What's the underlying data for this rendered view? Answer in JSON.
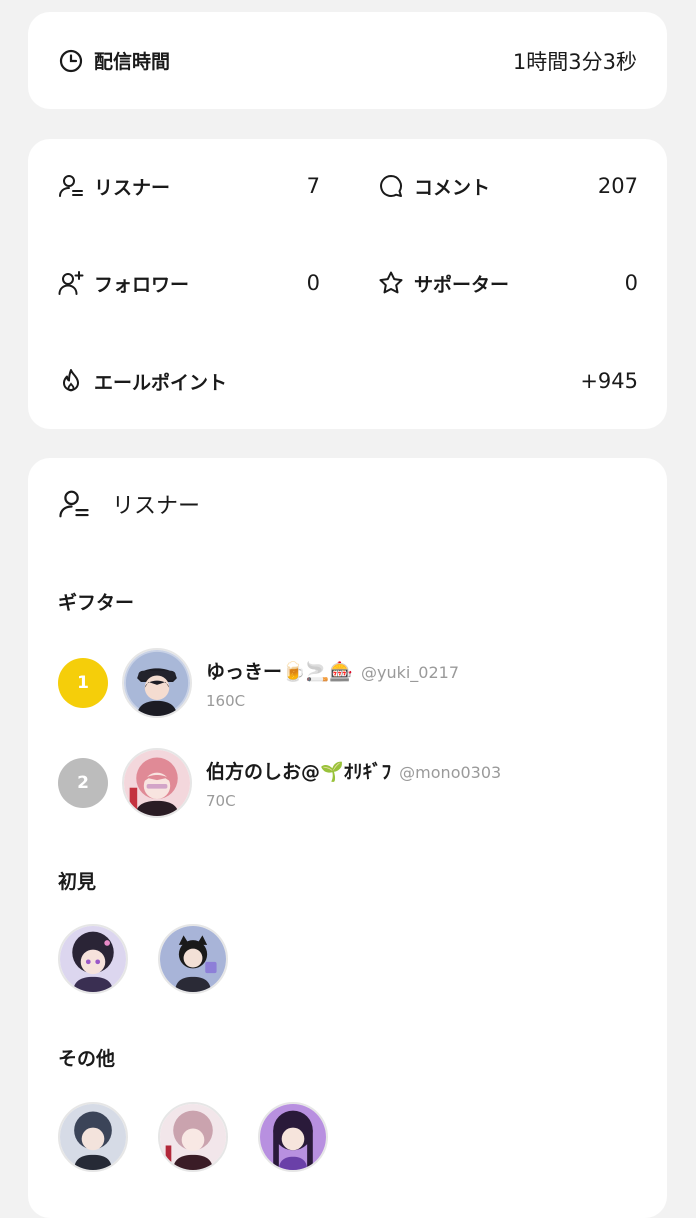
{
  "broadcast": {
    "label": "配信時間",
    "value": "1時間3分3秒"
  },
  "stats": {
    "listeners": {
      "label": "リスナー",
      "value": "7"
    },
    "comments": {
      "label": "コメント",
      "value": "207"
    },
    "followers": {
      "label": "フォロワー",
      "value": "0"
    },
    "supporters": {
      "label": "サポーター",
      "value": "0"
    },
    "cheer_points": {
      "label": "エールポイント",
      "value": "+945"
    }
  },
  "listeners_section": {
    "title": "リスナー",
    "gifters_heading": "ギフター",
    "gifters": [
      {
        "rank": "1",
        "name": "ゆっきー🍺🚬🎰",
        "handle": "@yuki_0217",
        "coins": "160C"
      },
      {
        "rank": "2",
        "name": "伯方のしお@🌱ｵﾘｷﾞﾌ",
        "handle": "@mono0303",
        "coins": "70C"
      }
    ],
    "first_time_heading": "初見",
    "others_heading": "その他"
  },
  "colors": {
    "gold": "#f5ce0a",
    "silver": "#bcbcbc",
    "muted": "#9a9a9a"
  }
}
